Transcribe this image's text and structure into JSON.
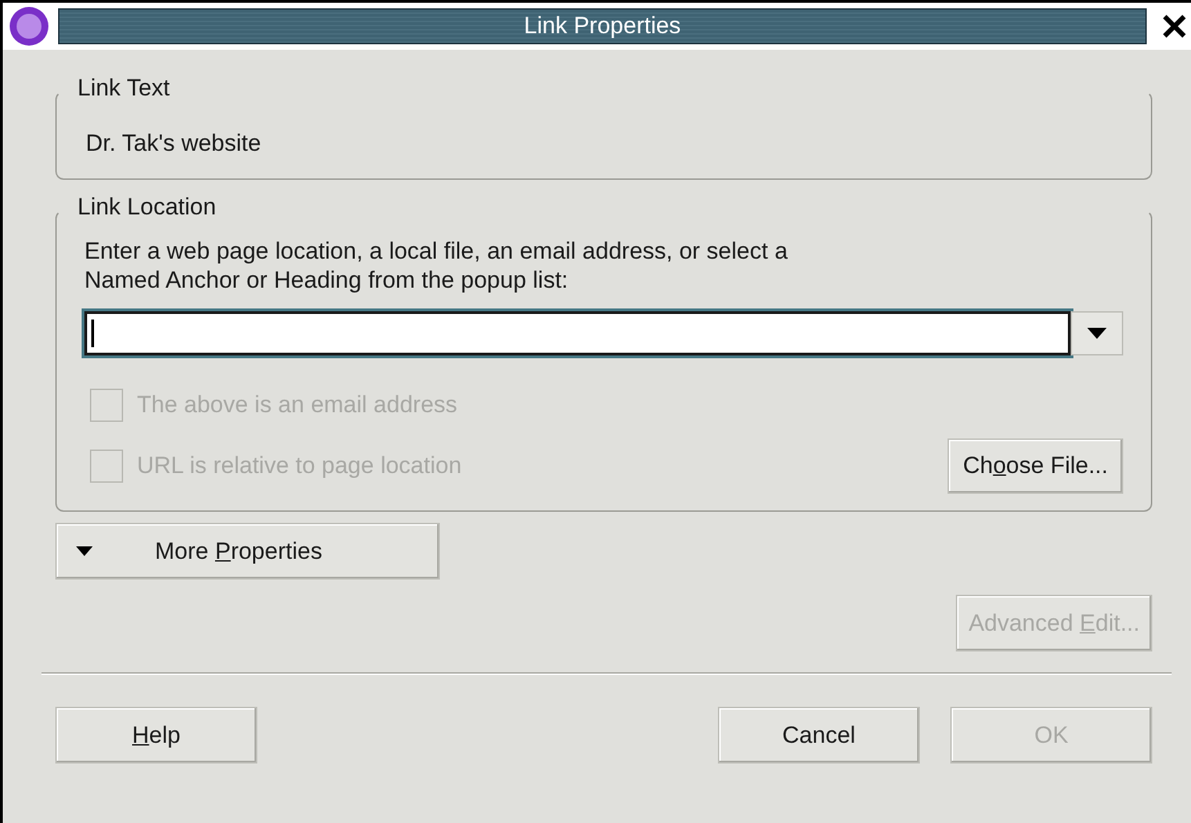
{
  "window": {
    "title": "Link Properties"
  },
  "link_text": {
    "label": "Link Text",
    "value": "Dr. Tak's website"
  },
  "link_location": {
    "label": "Link Location",
    "instructions": "Enter a web page location, a local file, an email address, or select a\nNamed Anchor or Heading from the popup list:",
    "field": {
      "focused": true
    },
    "checkboxes": [
      {
        "label": "The above is an email address",
        "checked": false,
        "disabled": true
      },
      {
        "label": "URL is relative to page location",
        "checked": false,
        "disabled": true
      }
    ],
    "choose_button": {
      "label": [
        {
          "text": "Ch",
          "underlined": false
        },
        {
          "text": "o",
          "underlined": true
        },
        {
          "text": "ose File...",
          "underlined": false
        }
      ],
      "disabled": false
    }
  },
  "more_button": {
    "label": [
      {
        "text": "More ",
        "underlined": false
      },
      {
        "text": "P",
        "underlined": true
      },
      {
        "text": "roperties",
        "underlined": false
      }
    ],
    "expanded": false
  },
  "advanced_button": {
    "label": [
      {
        "text": "Advanced ",
        "underlined": false
      },
      {
        "text": "E",
        "underlined": true
      },
      {
        "text": "dit...",
        "underlined": false
      }
    ],
    "disabled": true
  },
  "footer_buttons": [
    {
      "kind": "help",
      "label": [
        {
          "text": "H",
          "underlined": true
        },
        {
          "text": "elp",
          "underlined": false
        }
      ],
      "disabled": false
    },
    {
      "kind": "cancel",
      "label": [
        {
          "text": "Cancel",
          "underlined": false
        }
      ],
      "disabled": false
    },
    {
      "kind": "ok",
      "label": [
        {
          "text": "OK",
          "underlined": false
        }
      ],
      "disabled": true
    }
  ]
}
